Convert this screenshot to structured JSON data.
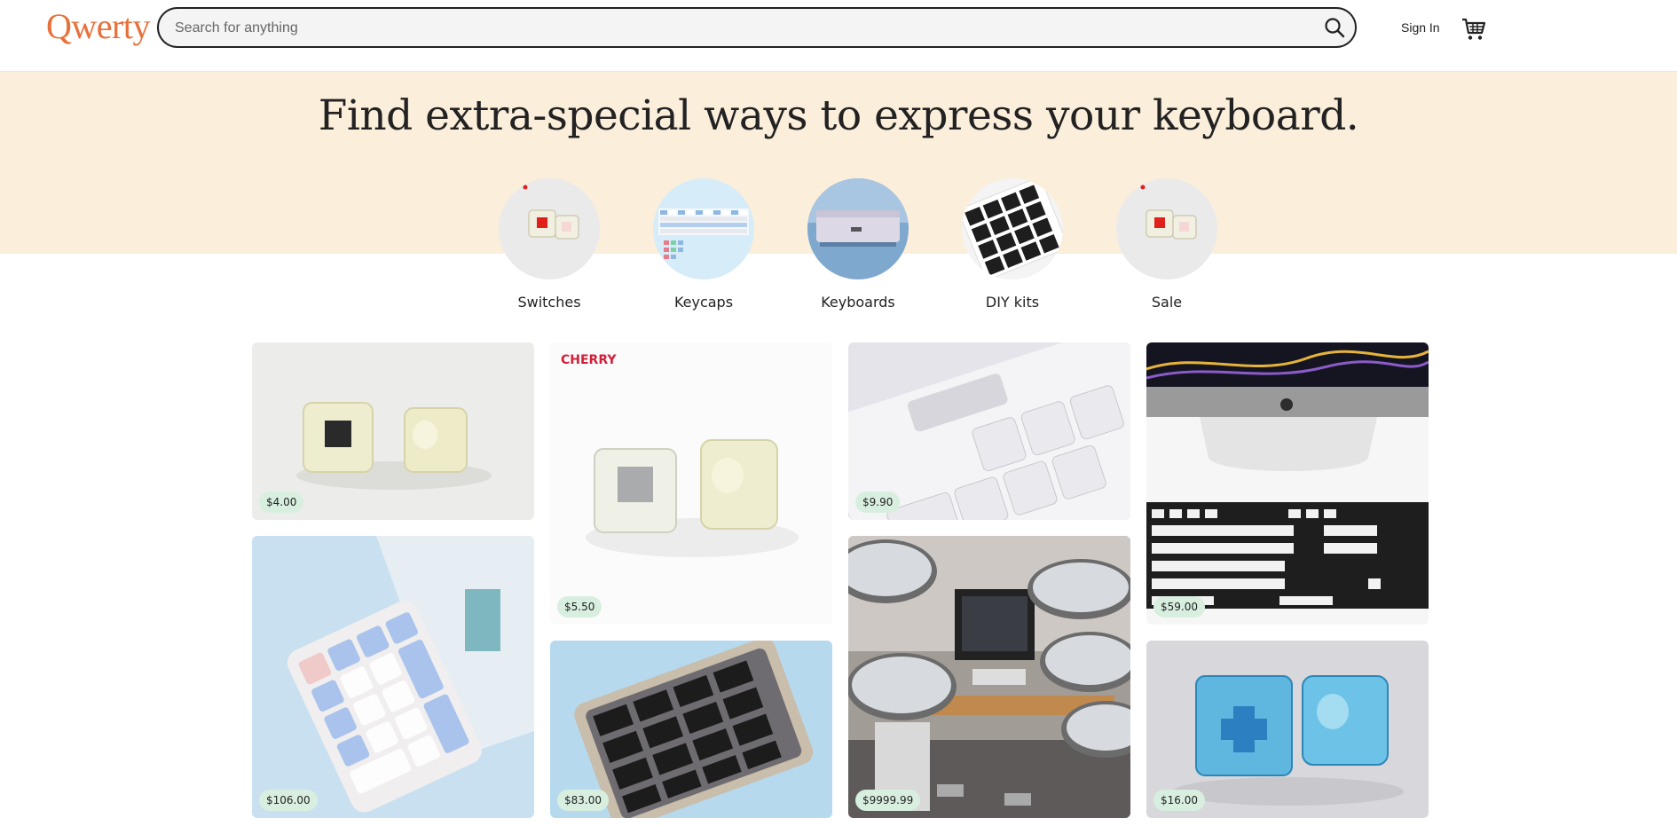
{
  "header": {
    "logo": "Qwerty",
    "search_placeholder": "Search for anything",
    "signin": "Sign In",
    "search_icon": "search-icon",
    "cart_icon": "cart-icon"
  },
  "hero": {
    "title": "Find extra-special ways to express your keyboard."
  },
  "categories": [
    {
      "label": "Switches"
    },
    {
      "label": "Keycaps"
    },
    {
      "label": "Keyboards"
    },
    {
      "label": "DIY kits"
    },
    {
      "label": "Sale"
    }
  ],
  "products": [
    {
      "price": "$4.00"
    },
    {
      "price": "$5.50",
      "brand": "CHERRY"
    },
    {
      "price": "$9.90"
    },
    {
      "price": "$59.00"
    },
    {
      "price": "$106.00"
    },
    {
      "price": "$83.00"
    },
    {
      "price": "$9999.99"
    },
    {
      "price": "$16.00"
    }
  ],
  "colors": {
    "logo": "#e8703a",
    "hero_bg": "#fbeedb",
    "price_badge": "#d8efe0"
  }
}
